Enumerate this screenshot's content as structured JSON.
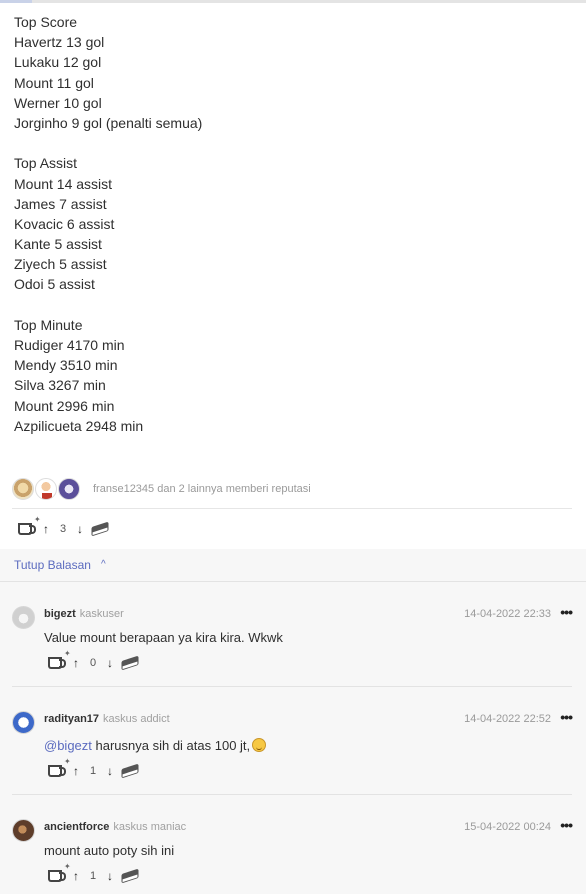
{
  "post": {
    "lines": [
      "Top Score",
      "Havertz 13 gol",
      "Lukaku 12 gol",
      "Mount 11 gol",
      "Werner 10 gol",
      "Jorginho 9 gol (penalti semua)",
      "",
      "Top Assist",
      "Mount 14 assist",
      "James 7 assist",
      "Kovacic 6 assist",
      "Kante 5 assist",
      "Ziyech 5 assist",
      "Odoi 5 assist",
      "",
      "Top Minute",
      "Rudiger 4170 min",
      "Mendy 3510 min",
      "Silva 3267 min",
      "Mount 2996 min",
      "Azpilicueta 2948 min"
    ],
    "reputation_text": "franse12345 dan 2 lainnya memberi reputasi",
    "vote_count": "3"
  },
  "replies": {
    "toggle_label": "Tutup Balasan",
    "comments": [
      {
        "username": "bigezt",
        "rank": "kaskuser",
        "date": "14-04-2022 22:33",
        "text": "Value mount berapaan ya kira kira. Wkwk",
        "vote_count": "0"
      },
      {
        "username": "radityan17",
        "rank": "kaskus addict",
        "date": "14-04-2022 22:52",
        "mention": "@bigezt",
        "text": " harusnya sih di atas 100 jt,",
        "vote_count": "1"
      },
      {
        "username": "ancientforce",
        "rank": "kaskus maniac",
        "date": "15-04-2022 00:24",
        "text": "mount auto poty sih ini",
        "vote_count": "1"
      }
    ]
  },
  "icons": {
    "cendol": "cup-icon",
    "upvote": "arrow-up-icon",
    "downvote": "arrow-down-icon",
    "bata": "brick-icon",
    "more": "more-icon"
  },
  "colors": {
    "link": "#5b6bbf",
    "muted": "#9a9a9a",
    "reply_bg": "#f7f7f7"
  }
}
